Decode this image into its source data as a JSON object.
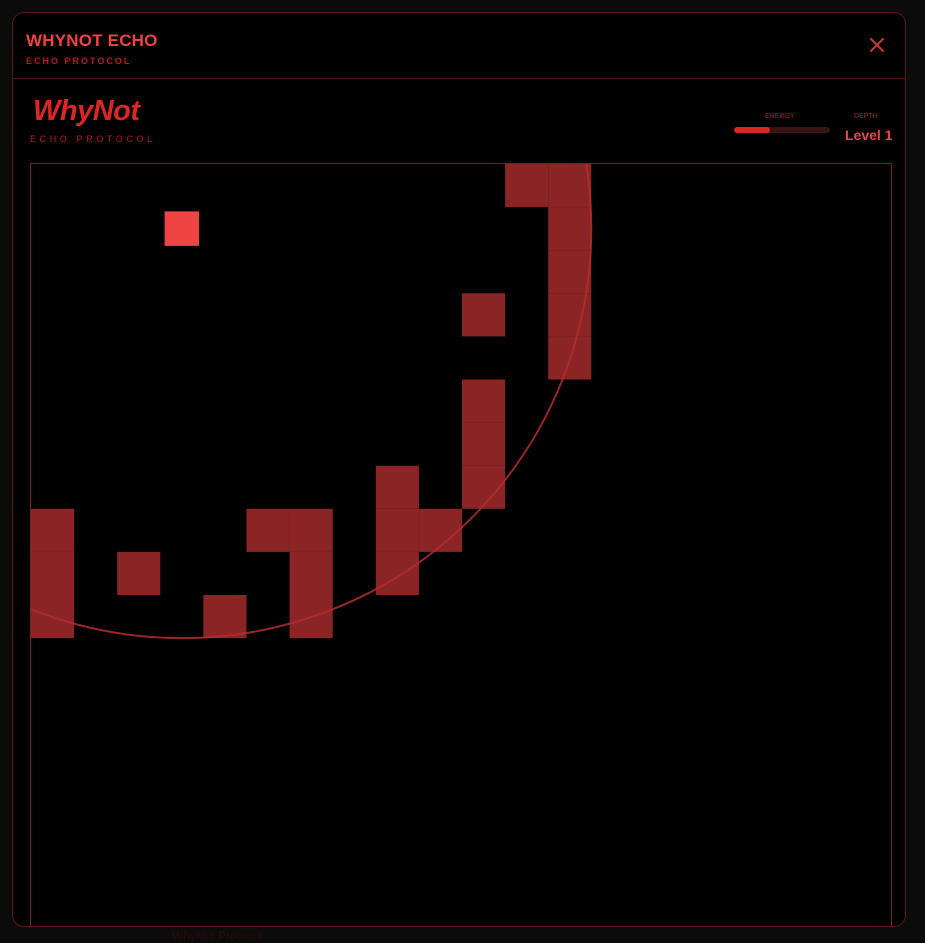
{
  "window": {
    "title": "WHYNOT ECHO",
    "subtitle": "ECHO PROTOCOL"
  },
  "hud": {
    "logo": "WhyNot",
    "logo_subtitle": "ECHO PROTOCOL",
    "energy_label": "ENERGY",
    "energy_fraction": 0.38,
    "depth_label": "DEPTH",
    "depth_value": "Level 1"
  },
  "game": {
    "grid_columns": 20,
    "player": {
      "col": 3,
      "row": 1
    },
    "walls": [
      {
        "col": 11,
        "row": 0
      },
      {
        "col": 12,
        "row": 0
      },
      {
        "col": 12,
        "row": 1
      },
      {
        "col": 12,
        "row": 2
      },
      {
        "col": 12,
        "row": 3
      },
      {
        "col": 12,
        "row": 4
      },
      {
        "col": 10,
        "row": 3
      },
      {
        "col": 10,
        "row": 5
      },
      {
        "col": 10,
        "row": 6
      },
      {
        "col": 10,
        "row": 7
      },
      {
        "col": 8,
        "row": 7
      },
      {
        "col": 8,
        "row": 8
      },
      {
        "col": 8,
        "row": 9
      },
      {
        "col": 9,
        "row": 8
      },
      {
        "col": 5,
        "row": 8
      },
      {
        "col": 6,
        "row": 8
      },
      {
        "col": 6,
        "row": 9
      },
      {
        "col": 6,
        "row": 10
      },
      {
        "col": 4,
        "row": 10
      },
      {
        "col": 2,
        "row": 9
      },
      {
        "col": 0,
        "row": 8
      },
      {
        "col": 0,
        "row": 9
      },
      {
        "col": 0,
        "row": 10
      }
    ],
    "echo_radius_cells": 9.5
  },
  "colors": {
    "accent": "#ef4444",
    "wall": "#8b2525",
    "player": "#ef4444",
    "echo_ring": "#b32d2d",
    "background": "#000000"
  },
  "icons": {
    "close": "close-icon"
  },
  "footer": "WhyNot Protocol"
}
